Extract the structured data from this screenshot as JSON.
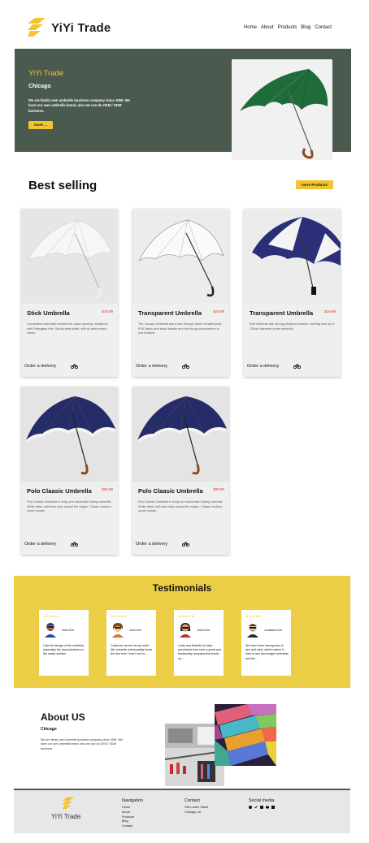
{
  "brand": {
    "name": "YiYi Trade",
    "color": "#f2c432",
    "dark": "#4b5a4e"
  },
  "nav": {
    "items": [
      "Home",
      "About",
      "Products",
      "Blog",
      "Contact"
    ]
  },
  "hero": {
    "title": "YiYi Trade",
    "location": "Chicago",
    "text": "We are family own umbrella business company since 1996. We have our own umbrella brand, also we can do OEM / ODM business.",
    "button": "more ..."
  },
  "best": {
    "title": "Best selling",
    "more_button": "more Products",
    "products": [
      {
        "name": "Stick Umbrella",
        "price": "$19.99",
        "desc": "Convenient automatic function for quick opening, windproof with Fiberglass ribs, Sturdy steel shaft, with all parts match colors.",
        "order": "Order a delivery",
        "icon": "motorbike-icon"
      },
      {
        "name": "Transparent Umbrella",
        "price": "$19.99",
        "desc": "The Canopy Umbrella has a see-through dome of waterproof POE fabric and black handle and trim for good protection in wet weather.",
        "order": "Order a delivery",
        "icon": "motorbike-icon"
      },
      {
        "name": "Transparent Umbrella",
        "price": "$19.99",
        "desc": "Golf umbrella with strong windproof system, and big size up to 130cm diameter under umbrella.",
        "order": "Order a delivery",
        "icon": "motorbike-icon"
      },
      {
        "name": "Polo Claasic Umbrella",
        "price": "$29.99",
        "desc": "Polo Classic Umbrella is a big size automatic folding umbrella. White fabric with blue strip around the edges. Classic woddon crook handle.",
        "order": "Order a delivery",
        "icon": "motorbike-icon"
      },
      {
        "name": "Polo Claasic Umbrella",
        "price": "$29.99",
        "desc": "Polo Classic Umbrella is a big size automatic folding umbrella. White fabric with blue strip around the edges. Classic woddon crook handle.",
        "order": "Order a delivery",
        "icon": "motorbike-icon"
      }
    ]
  },
  "testimonials": {
    "title": "Testimonials",
    "items": [
      {
        "stars": "★★★★★",
        "name": "Jane Doe",
        "quote": "I like the design of the umbrella, especially the cloud pictures on the inside surface."
      },
      {
        "stars": "★★★★★",
        "name": "John Doe",
        "quote": "Customer service is top notch. My umbrella unfortunately broke the first time I took it out to..."
      },
      {
        "stars": "★★★★★",
        "name": "Janet Doe",
        "quote": "I was very thankful to have purchased from such a great and trustworthy company that backs up..."
      },
      {
        "stars": "★★★★★",
        "name": "Jonathan Doe",
        "quote": "We have been having tons of rain and wind, which makes it hard to use low budget umbrellas and the..."
      }
    ]
  },
  "about": {
    "title": "About US",
    "location": "Chicago",
    "text": "We are family own umbrella business company since 1996. We have our own umbrella brand, also we can do OEM / ODM business."
  },
  "footer": {
    "brand": "YiYi Trade",
    "nav_title": "Navigation",
    "nav_items": [
      "Home",
      "About",
      "Products",
      "Blog",
      "Contact"
    ],
    "contact_title": "Contact",
    "contact_lines": [
      "208 Lorem Street",
      "Chicago, us"
    ],
    "social_title": "Social media"
  }
}
